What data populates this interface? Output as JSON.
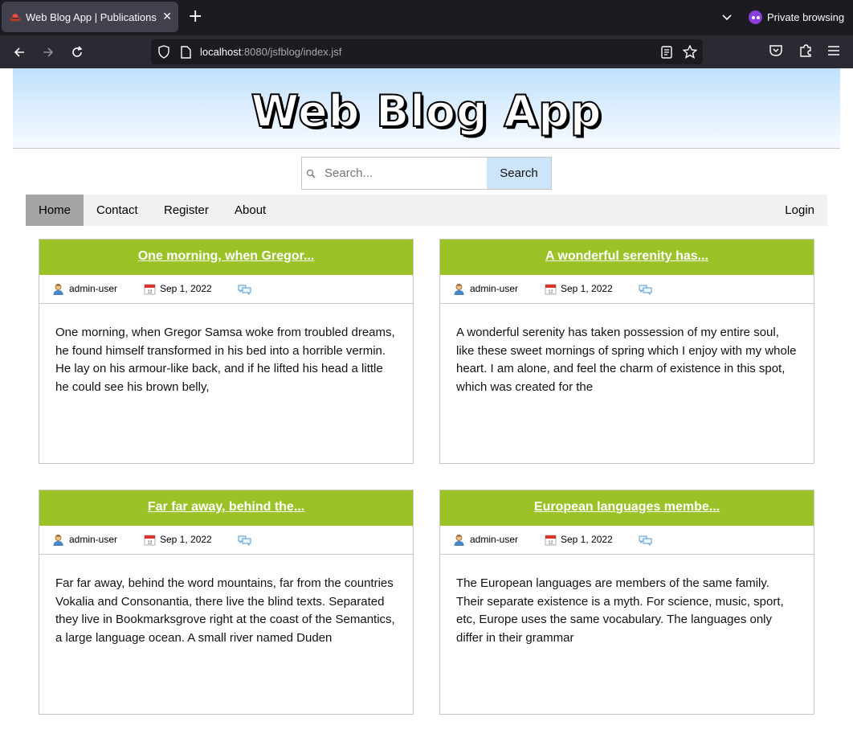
{
  "browser": {
    "tab_title": "Web Blog App | Publications",
    "private_label": "Private browsing",
    "url_host": "localhost",
    "url_rest": ":8080/jsfblog/index.jsf"
  },
  "site": {
    "title": "Web Blog App"
  },
  "search": {
    "placeholder": "Search...",
    "button": "Search"
  },
  "menu": {
    "items": [
      "Home",
      "Contact",
      "Register",
      "About"
    ],
    "login": "Login"
  },
  "posts": [
    {
      "title": "One morning, when Gregor...",
      "author": "admin-user",
      "date": "Sep 1, 2022",
      "excerpt": "One morning, when Gregor Samsa woke from troubled dreams, he found himself transformed in his bed into a horrible vermin. He lay on his armour-like back, and if he lifted his head a little he could see his brown belly,"
    },
    {
      "title": "A wonderful serenity has...",
      "author": "admin-user",
      "date": "Sep 1, 2022",
      "excerpt": "A wonderful serenity has taken possession of my entire soul, like these sweet mornings of spring which I enjoy with my whole heart. I am alone, and feel the charm of existence in this spot, which was created for the"
    },
    {
      "title": "Far far away, behind the...",
      "author": "admin-user",
      "date": "Sep 1, 2022",
      "excerpt": "Far far away, behind the word mountains, far from the countries Vokalia and Consonantia, there live the blind texts. Separated they live in Bookmarksgrove right at the coast of the Semantics, a large language ocean. A small river named Duden"
    },
    {
      "title": "European languages membe...",
      "author": "admin-user",
      "date": "Sep 1, 2022",
      "excerpt": "The European languages are members of the same family. Their separate existence is a myth. For science, music, sport, etc, Europe uses the same vocabulary. The languages only differ in their grammar"
    }
  ],
  "colors": {
    "card_header": "#9bc227",
    "search_button": "#cce5fb",
    "menu_active": "#a5a5a5"
  }
}
